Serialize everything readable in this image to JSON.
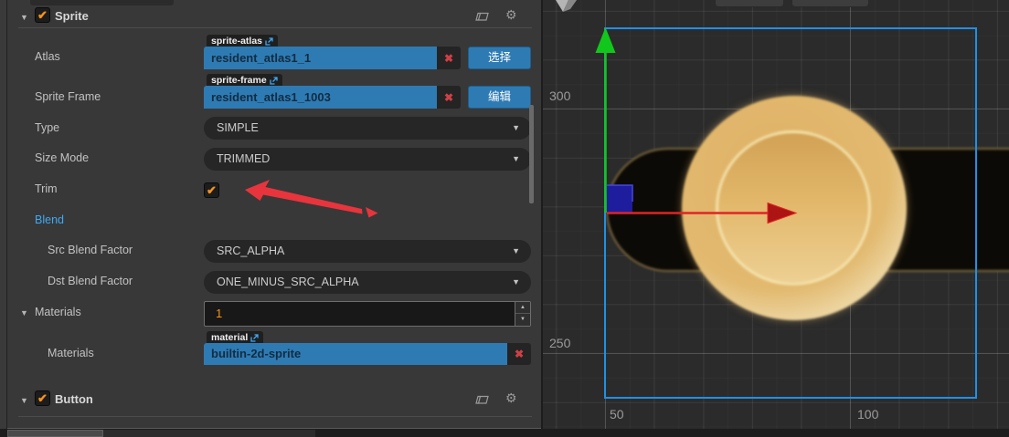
{
  "inspector": {
    "sprite": {
      "title": "Sprite",
      "enabled": true,
      "header_icons": [
        "book-icon",
        "gear-icon"
      ],
      "rows": {
        "atlas": {
          "label": "Atlas",
          "asset_type": "sprite-atlas",
          "value": "resident_atlas1_1",
          "action": "选择"
        },
        "sprite_frame": {
          "label": "Sprite Frame",
          "asset_type": "sprite-frame",
          "value": "resident_atlas1_1003",
          "action": "编辑"
        },
        "type": {
          "label": "Type",
          "value": "SIMPLE"
        },
        "size_mode": {
          "label": "Size Mode",
          "value": "TRIMMED"
        },
        "trim": {
          "label": "Trim",
          "checked": true
        },
        "blend": {
          "label": "Blend"
        },
        "src_blend": {
          "label": "Src Blend Factor",
          "value": "SRC_ALPHA"
        },
        "dst_blend": {
          "label": "Dst Blend Factor",
          "value": "ONE_MINUS_SRC_ALPHA"
        },
        "materials_size": {
          "label": "Materials",
          "value": "1"
        },
        "material": {
          "label": "Materials",
          "asset_type": "material",
          "value": "builtin-2d-sprite"
        }
      }
    },
    "button_section": {
      "title": "Button",
      "enabled": true,
      "header_icons": [
        "book-icon",
        "gear-icon"
      ]
    }
  },
  "scene": {
    "ruler": {
      "y_top": "300",
      "y_bottom": "250",
      "x_left": "50",
      "x_right": "100"
    },
    "gizmos": [
      "y-axis-green-arrow",
      "x-axis-red-arrow",
      "anchor-blue-square",
      "selection-rect",
      "view-orientation-gizmo"
    ],
    "annotation": "red-arrow-pointing-to-trim-checkbox"
  },
  "colors": {
    "accent_blue": "#2e7bb4",
    "checkbox_orange": "#f6921e",
    "blend_link_blue": "#3fa9f5",
    "annotation_red": "#e8343c",
    "axis_green": "#12c71b",
    "axis_red": "#e02424",
    "selection_blue": "#2090e8",
    "panel_bg": "#383838",
    "scene_bg": "#2b2b2b"
  }
}
